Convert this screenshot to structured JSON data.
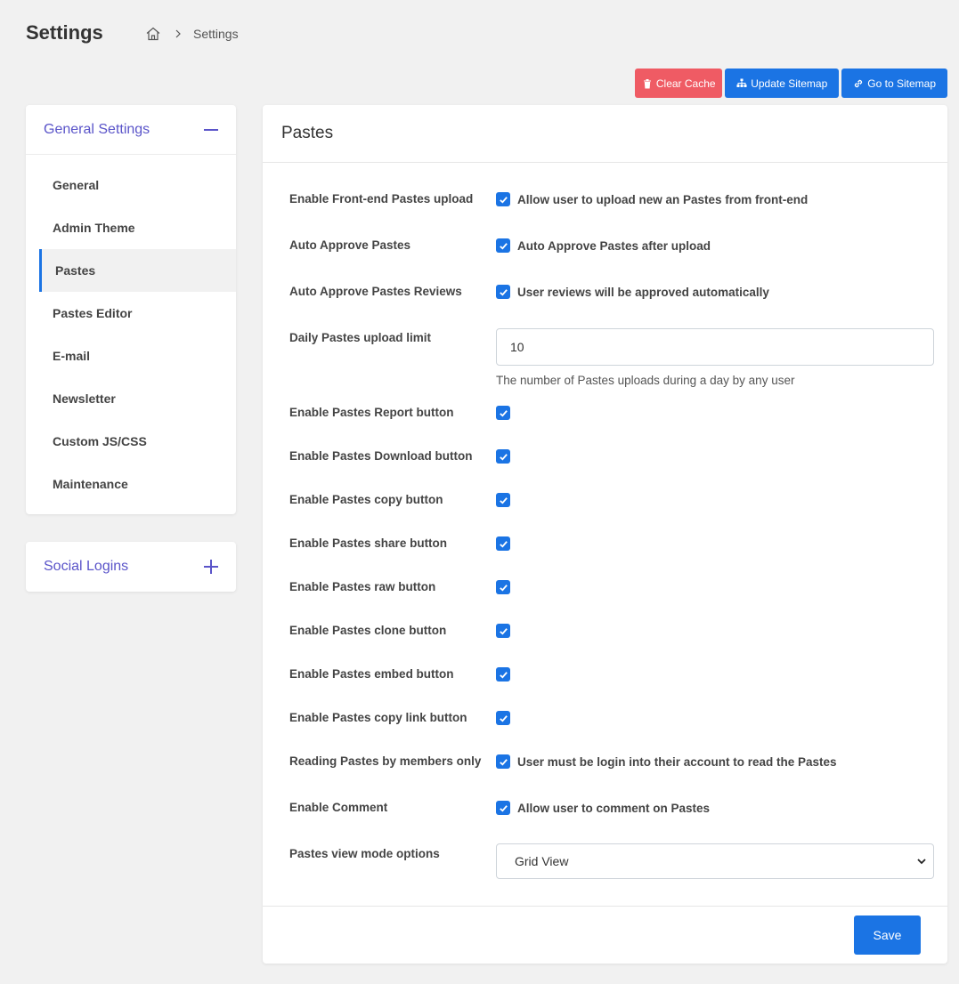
{
  "page": {
    "title": "Settings"
  },
  "breadcrumb": {
    "current": "Settings"
  },
  "actions": {
    "clear_cache": "Clear Cache",
    "update_sitemap": "Update Sitemap",
    "go_to_sitemap": "Go to Sitemap"
  },
  "sidebar": {
    "general": {
      "title": "General Settings",
      "items": [
        {
          "label": "General"
        },
        {
          "label": "Admin Theme"
        },
        {
          "label": "Pastes",
          "active": true
        },
        {
          "label": "Pastes Editor"
        },
        {
          "label": "E-mail"
        },
        {
          "label": "Newsletter"
        },
        {
          "label": "Custom JS/CSS"
        },
        {
          "label": "Maintenance"
        }
      ]
    },
    "social": {
      "title": "Social Logins"
    }
  },
  "main": {
    "title": "Pastes",
    "rows": [
      {
        "label": "Enable Front-end Pastes upload",
        "checked": true,
        "text": "Allow user to upload new an Pastes from front-end"
      },
      {
        "label": "Auto Approve Pastes",
        "checked": true,
        "text": "Auto Approve Pastes after upload"
      },
      {
        "label": "Auto Approve Pastes Reviews",
        "checked": true,
        "text": "User reviews will be approved automatically"
      },
      {
        "label": "Daily Pastes upload limit",
        "value": "10",
        "help": "The number of Pastes uploads during a day by any user"
      },
      {
        "label": "Enable Pastes Report button",
        "checked": true
      },
      {
        "label": "Enable Pastes Download button",
        "checked": true
      },
      {
        "label": "Enable Pastes copy button",
        "checked": true
      },
      {
        "label": "Enable Pastes share button",
        "checked": true
      },
      {
        "label": "Enable Pastes raw button",
        "checked": true
      },
      {
        "label": "Enable Pastes clone button",
        "checked": true
      },
      {
        "label": "Enable Pastes embed button",
        "checked": true
      },
      {
        "label": "Enable Pastes copy link button",
        "checked": true
      },
      {
        "label": "Reading Pastes by members only",
        "checked": true,
        "text": "User must be login into their account to read the Pastes"
      },
      {
        "label": "Enable Comment",
        "checked": true,
        "text": "Allow user to comment on Pastes"
      },
      {
        "label": "Pastes view mode options",
        "selected": "Grid View"
      }
    ],
    "save_label": "Save"
  },
  "colors": {
    "accent": "#1b74e4",
    "danger": "#ef5b64",
    "sidebar_heading": "#5a54c9"
  }
}
